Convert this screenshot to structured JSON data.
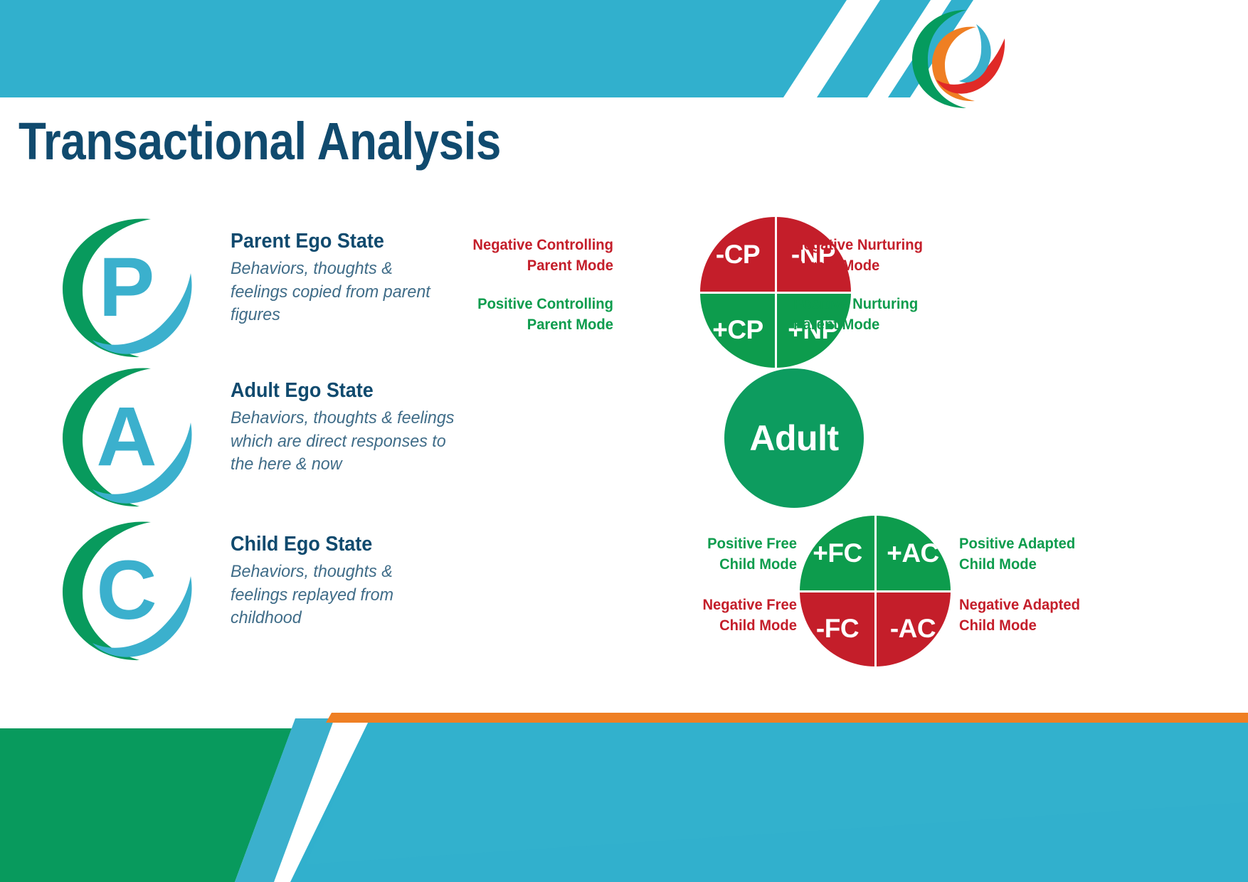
{
  "page": {
    "title": "Transactional Analysis"
  },
  "colors": {
    "teal": "#31b0cd",
    "navy": "#104a6e",
    "green": "#0d9c5f",
    "red": "#c41e2a",
    "orange": "#ef7f23",
    "light_blue": "#3bb0cd",
    "body_text": "#3f6c88"
  },
  "logo": {
    "name": "brand-swirl-logo",
    "arc_colors": [
      "#059b5e",
      "#ef7f23",
      "#e02a27",
      "#3bb0cd"
    ]
  },
  "ego_states": [
    {
      "letter": "P",
      "title": "Parent Ego State",
      "description": "Behaviors, thoughts & feelings copied from parent figures"
    },
    {
      "letter": "A",
      "title": "Adult Ego State",
      "description": "Behaviors, thoughts & feelings which are direct responses to the here & now"
    },
    {
      "letter": "C",
      "title": "Child Ego State",
      "description": "Behaviors, thoughts & feelings replayed from childhood"
    }
  ],
  "parent_circle": {
    "name": "parent-modes-circle",
    "quadrants": [
      {
        "position": "top-left",
        "code": "-CP",
        "color": "#c41e2a"
      },
      {
        "position": "top-right",
        "code": "-NP",
        "color": "#c41e2a"
      },
      {
        "position": "bottom-left",
        "code": "+CP",
        "color": "#0d9c4d"
      },
      {
        "position": "bottom-right",
        "code": "+NP",
        "color": "#0d9c4d"
      }
    ],
    "labels": {
      "top_left": {
        "line1": "Negative Controlling",
        "line2": "Parent Mode",
        "tone": "negative"
      },
      "bottom_left": {
        "line1": "Positive Controlling",
        "line2": "Parent Mode",
        "tone": "positive"
      },
      "top_right": {
        "line1": "Negative Nurturing",
        "line2": "Parent Mode",
        "tone": "negative"
      },
      "bottom_right": {
        "line1": "Positive Nurturing",
        "line2": "Parent Mode",
        "tone": "positive"
      }
    }
  },
  "adult_circle": {
    "name": "adult-circle",
    "label": "Adult",
    "color": "#0d9c5f"
  },
  "child_circle": {
    "name": "child-modes-circle",
    "quadrants": [
      {
        "position": "top-left",
        "code": "+FC",
        "color": "#0d9c4d"
      },
      {
        "position": "top-right",
        "code": "+AC",
        "color": "#0d9c4d"
      },
      {
        "position": "bottom-left",
        "code": "-FC",
        "color": "#c41e2a"
      },
      {
        "position": "bottom-right",
        "code": "-AC",
        "color": "#c41e2a"
      }
    ],
    "labels": {
      "top_left": {
        "line1": "Positive Free",
        "line2": "Child Mode",
        "tone": "positive"
      },
      "bottom_left": {
        "line1": "Negative Free",
        "line2": "Child Mode",
        "tone": "negative"
      },
      "top_right": {
        "line1": "Positive Adapted",
        "line2": "Child Mode",
        "tone": "positive"
      },
      "bottom_right": {
        "line1": "Negative Adapted",
        "line2": "Child Mode",
        "tone": "negative"
      }
    }
  }
}
